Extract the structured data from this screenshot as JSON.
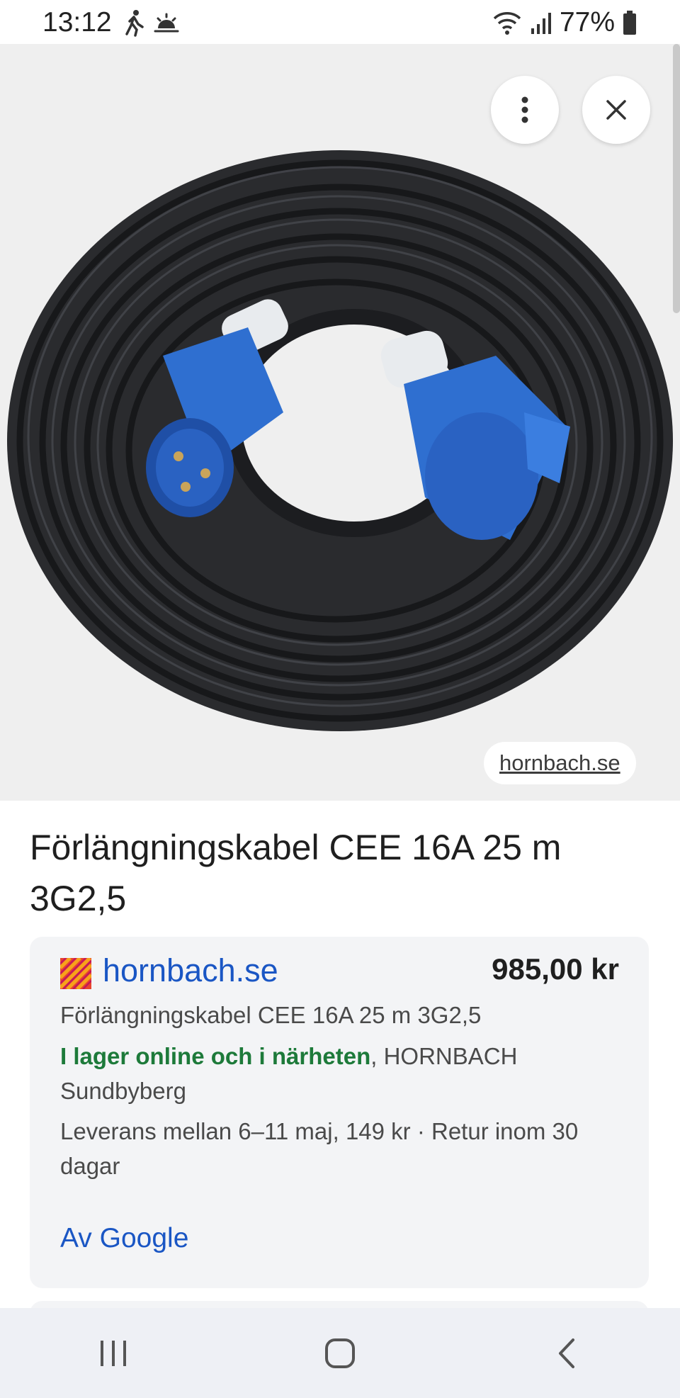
{
  "status_bar": {
    "time": "13:12",
    "battery": "77%",
    "icons": [
      "walking-icon",
      "sunrise-icon",
      "wifi-icon",
      "signal-icon",
      "battery-icon"
    ]
  },
  "image_viewer": {
    "image_subject": "black extension cable with blue CEE plug and socket",
    "source_chip": "hornbach.se",
    "more_button_icon": "more-vert-icon",
    "close_button_icon": "close-icon"
  },
  "product": {
    "title": "Förlängningskabel CEE 16A 25 m 3G2,5"
  },
  "offer": {
    "merchant": "hornbach.se",
    "price": "985,00 kr",
    "product_name": "Förlängningskabel CEE 16A 25 m 3G2,5",
    "stock_status": "I lager online och i närheten",
    "stock_location": ", HORNBACH Sundbyberg",
    "delivery": "Leverans mellan 6–11 maj, 149 kr · Retur inom 30 dagar",
    "by_google": "Av Google"
  },
  "colors": {
    "link_blue": "#1a56c4",
    "stock_green": "#1d7a3a",
    "plug_blue": "#2f6fd0"
  },
  "nav_bar": {
    "icons": [
      "recent-apps-icon",
      "home-icon",
      "back-icon"
    ]
  }
}
